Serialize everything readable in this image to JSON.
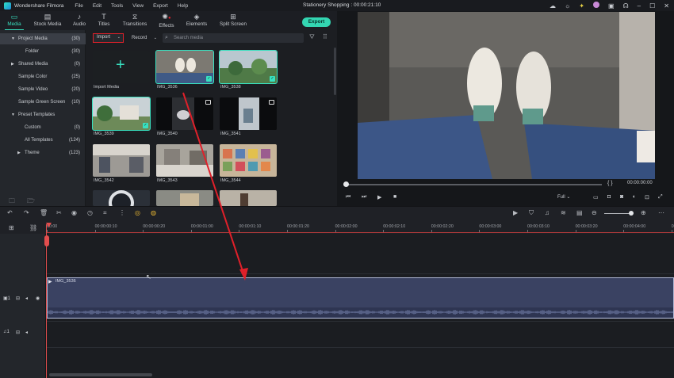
{
  "app": {
    "name": "Wondershare Filmora",
    "project_title": "Stationery Shopping : 00:00:21:10"
  },
  "menu": [
    "File",
    "Edit",
    "Tools",
    "View",
    "Export",
    "Help"
  ],
  "window_icons": [
    "cloud-icon",
    "sun-icon",
    "lightbulb-icon",
    "avatar-icon",
    "save-icon",
    "support-icon",
    "minimize-icon",
    "maximize-icon",
    "close-icon"
  ],
  "toolbar": {
    "tabs": [
      {
        "label": "Media",
        "icon": "media-icon",
        "active": true
      },
      {
        "label": "Stock Media",
        "icon": "stock-media-icon",
        "active": false
      },
      {
        "label": "Audio",
        "icon": "audio-icon",
        "active": false
      },
      {
        "label": "Titles",
        "icon": "titles-icon",
        "active": false
      },
      {
        "label": "Transitions",
        "icon": "transitions-icon",
        "active": false
      },
      {
        "label": "Effects",
        "icon": "effects-icon",
        "active": false
      },
      {
        "label": "Elements",
        "icon": "elements-icon",
        "active": false
      },
      {
        "label": "Split Screen",
        "icon": "split-screen-icon",
        "active": false
      }
    ],
    "export_label": "Export"
  },
  "sidebar": {
    "items": [
      {
        "label": "Project Media",
        "count": "(30)",
        "arrow": "▼",
        "selected": true
      },
      {
        "label": "Folder",
        "count": "(30)"
      },
      {
        "label": "Shared Media",
        "count": "(0)",
        "arrow": "▶"
      },
      {
        "label": "Sample Color",
        "count": "(25)"
      },
      {
        "label": "Sample Video",
        "count": "(20)"
      },
      {
        "label": "Sample Green Screen",
        "count": "(10)"
      },
      {
        "label": "Preset Templates",
        "count": "",
        "arrow": "▼"
      },
      {
        "label": "Custom",
        "count": "(0)"
      },
      {
        "label": "All Templates",
        "count": "(124)"
      },
      {
        "label": "Theme",
        "count": "(123)",
        "arrow": "▶"
      }
    ]
  },
  "media_panel": {
    "import_label": "Import",
    "record_label": "Record",
    "search_placeholder": "Search media",
    "import_media_label": "Import Media",
    "clips": [
      "IMG_3536",
      "IMG_3538",
      "IMG_3539",
      "IMG_3540",
      "IMG_3541",
      "IMG_3542",
      "IMG_3543",
      "IMG_3544"
    ]
  },
  "player": {
    "timecode": "00:00:00:00",
    "braces": "{   }",
    "zoom": "Full"
  },
  "timeline": {
    "ruler_ticks": [
      "00:00",
      "00:00:00:10",
      "00:00:00:20",
      "00:00:01:00",
      "00:00:01:10",
      "00:00:01:20",
      "00:00:02:00",
      "00:00:02:10",
      "00:00:02:20",
      "00:00:03:00",
      "00:00:03:10",
      "00:00:03:20",
      "00:00:04:00",
      "00:00:0"
    ],
    "clip_name": "IMG_3536",
    "video_track_label": "1",
    "audio_track_label": "1"
  },
  "colors": {
    "accent": "#38e1c0",
    "import_highlight": "#e0202a",
    "playhead": "#e24d4d",
    "clip": "#3a4262",
    "arrow": "#e0202a"
  }
}
